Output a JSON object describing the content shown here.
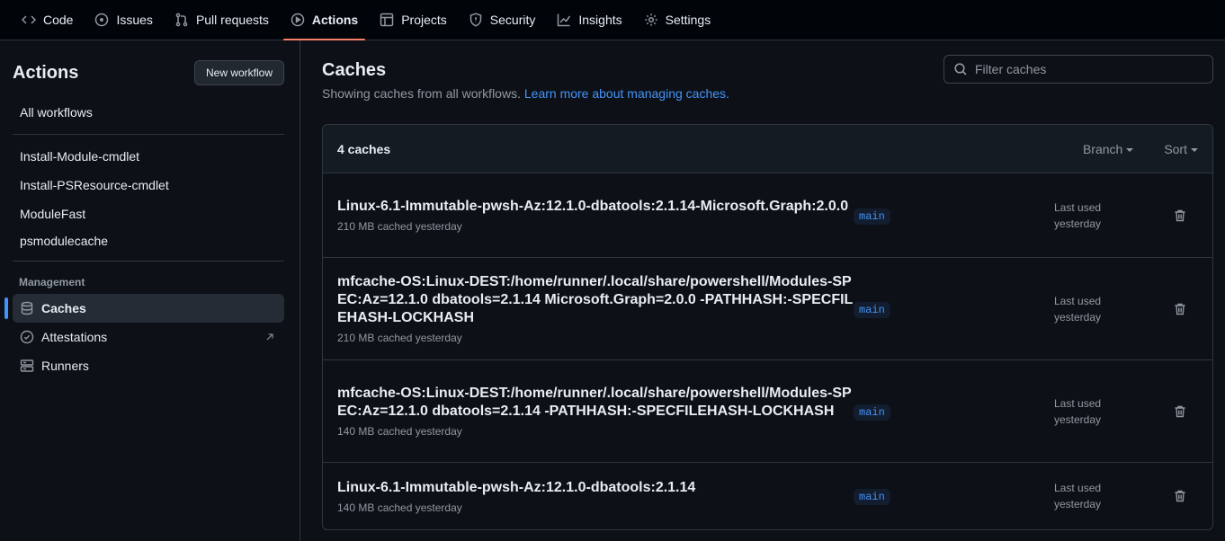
{
  "nav": {
    "tabs": [
      {
        "label": "Code",
        "icon": "code-icon"
      },
      {
        "label": "Issues",
        "icon": "issue-icon"
      },
      {
        "label": "Pull requests",
        "icon": "pull-request-icon"
      },
      {
        "label": "Actions",
        "icon": "play-icon",
        "active": true
      },
      {
        "label": "Projects",
        "icon": "table-icon"
      },
      {
        "label": "Security",
        "icon": "shield-icon"
      },
      {
        "label": "Insights",
        "icon": "graph-icon"
      },
      {
        "label": "Settings",
        "icon": "gear-icon"
      }
    ]
  },
  "sidebar": {
    "title": "Actions",
    "new_workflow": "New workflow",
    "all_workflows": "All workflows",
    "workflows": [
      "Install-Module-cmdlet",
      "Install-PSResource-cmdlet",
      "ModuleFast",
      "psmodulecache"
    ],
    "management_label": "Management",
    "management": [
      {
        "label": "Caches",
        "icon": "database-icon",
        "active": true
      },
      {
        "label": "Attestations",
        "icon": "check-circle-icon",
        "external": true
      },
      {
        "label": "Runners",
        "icon": "server-icon"
      }
    ]
  },
  "main": {
    "title": "Caches",
    "subtitle": "Showing caches from all workflows.",
    "learn_more": "Learn more about managing caches.",
    "filter_placeholder": "Filter caches",
    "count": "4 caches",
    "branch_label": "Branch",
    "sort_label": "Sort",
    "caches": [
      {
        "name": "Linux-6.1-Immutable-pwsh-Az:12.1.0-dbatools:2.1.14-Microsoft.Graph:2.0.0",
        "meta": "210 MB cached yesterday",
        "branch": "main",
        "used_label": "Last used",
        "used_time": "yesterday"
      },
      {
        "name": "mfcache-OS:Linux-DEST:/home/runner/.local/share/powershell/Modules-SPEC:Az=12.1.0 dbatools=2.1.14 Microsoft.Graph=2.0.0 -PATHHASH:-SPECFILEHASH-LOCKHASH",
        "meta": "210 MB cached yesterday",
        "branch": "main",
        "used_label": "Last used",
        "used_time": "yesterday"
      },
      {
        "name": "mfcache-OS:Linux-DEST:/home/runner/.local/share/powershell/Modules-SPEC:Az=12.1.0 dbatools=2.1.14 -PATHHASH:-SPECFILEHASH-LOCKHASH",
        "meta": "140 MB cached yesterday",
        "branch": "main",
        "used_label": "Last used",
        "used_time": "yesterday"
      },
      {
        "name": "Linux-6.1-Immutable-pwsh-Az:12.1.0-dbatools:2.1.14",
        "meta": "140 MB cached yesterday",
        "branch": "main",
        "used_label": "Last used",
        "used_time": "yesterday"
      }
    ]
  },
  "colors": {
    "accent": "#4493f8",
    "tab_underline": "#f78166",
    "background": "#0d1117"
  }
}
